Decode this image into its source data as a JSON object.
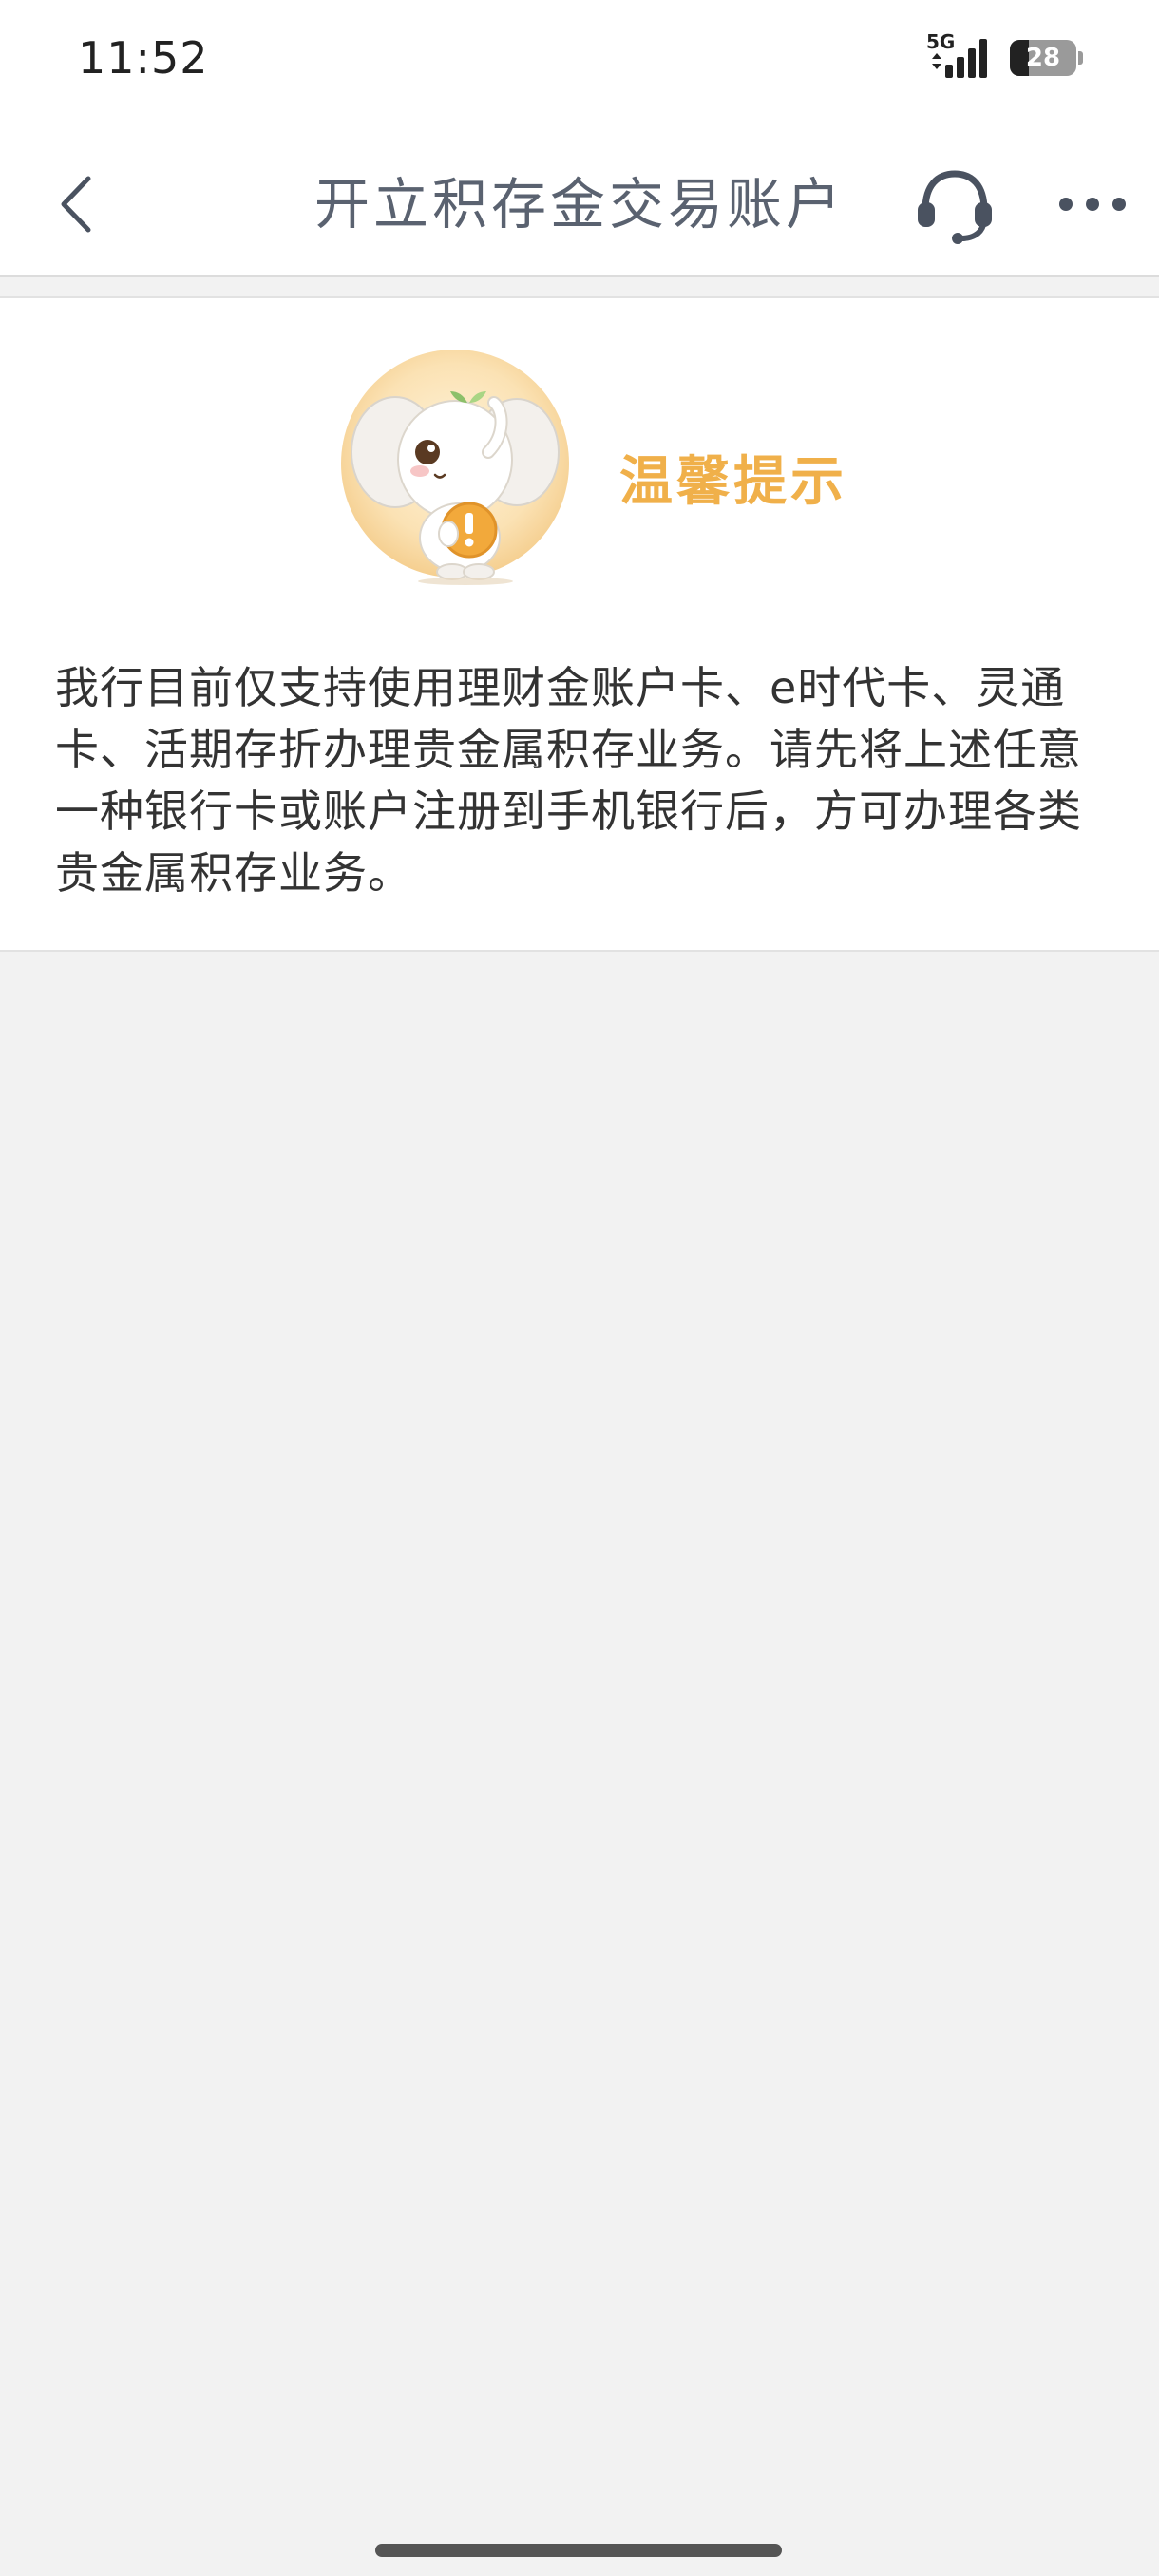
{
  "status_bar": {
    "time": "11:52",
    "network": "5G",
    "battery": "28"
  },
  "header": {
    "title": "开立积存金交易账户"
  },
  "notice": {
    "title": "温馨提示",
    "message": "我行目前仅支持使用理财金账户卡、e时代卡、灵通卡、活期存折办理贵金属积存业务。请先将上述任意一种银行卡或账户注册到手机银行后，方可办理各类贵金属积存业务。"
  },
  "colors": {
    "accent": "#f0b04a",
    "title_text": "#5a6270",
    "body_text": "#333333",
    "background": "#f2f2f2"
  },
  "icons": {
    "back": "chevron-left-icon",
    "service": "headset-icon",
    "more": "more-dots-icon",
    "mascot": "elephant-mascot-icon"
  }
}
